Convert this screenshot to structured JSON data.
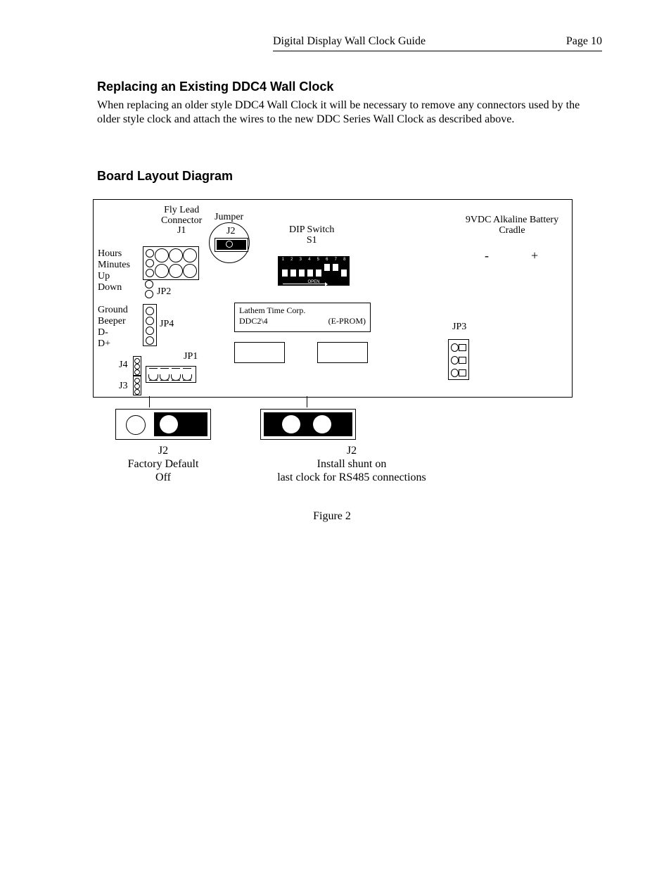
{
  "header": {
    "title": "Digital Display Wall Clock Guide",
    "page": "Page 10"
  },
  "section1": {
    "heading": "Replacing an Existing DDC4 Wall Clock",
    "body": "When replacing an older style DDC4 Wall Clock it will be necessary to remove any connectors used by the older style clock and attach the wires to the new DDC Series Wall Clock as described above."
  },
  "section2": {
    "heading": "Board Layout Diagram"
  },
  "diagram": {
    "flylead": {
      "line1": "Fly Lead",
      "line2": "Connector",
      "line3": "J1"
    },
    "jumper": {
      "title": "Jumper",
      "label": "J2"
    },
    "dipswitch": {
      "title": "DIP Switch",
      "label": "S1",
      "nums": [
        "1",
        "2",
        "3",
        "4",
        "5",
        "6",
        "7",
        "8"
      ],
      "open": "OPEN"
    },
    "battery": {
      "line1": "9VDC Alkaline Battery",
      "line2": "Cradle",
      "minus": "-",
      "plus": "+"
    },
    "leftpins1": [
      "Hours",
      "Minutes",
      "Up",
      "Down"
    ],
    "leftpins2": [
      "Ground",
      "Beeper",
      "D-",
      "D+"
    ],
    "jp2": "JP2",
    "jp4": "JP4",
    "jp1": "JP1",
    "j4": "J4",
    "j3": "J3",
    "jp3": "JP3",
    "eprom": {
      "left": "Lathem Time Corp.",
      "left2": "DDC2\\4",
      "right": "(E-PROM)"
    },
    "j2a": {
      "label": "J2",
      "line1": "Factory Default",
      "line2": "Off"
    },
    "j2b": {
      "label": "J2",
      "line1": "Install shunt on",
      "line2": "last clock for RS485 connections"
    },
    "figure": "Figure 2"
  }
}
